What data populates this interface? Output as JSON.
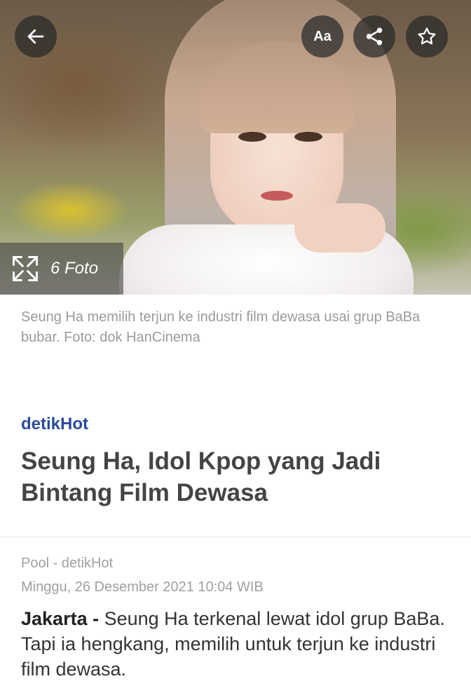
{
  "toolbar": {
    "back_icon": "arrow-left-icon",
    "font_label": "Aa",
    "share_icon": "share-icon",
    "star_icon": "star-icon"
  },
  "hero": {
    "gallery_icon": "expand-icon",
    "gallery_label": "6 Foto"
  },
  "article": {
    "caption": "Seung Ha memilih terjun ke industri film dewasa usai grup BaBa bubar. Foto: dok HanCinema",
    "channel": "detikHot",
    "title": "Seung Ha, Idol Kpop yang Jadi Bintang Film Dewasa",
    "author": "Pool - detikHot",
    "date": "Minggu, 26 Desember 2021 10:04 WIB",
    "dateline": "Jakarta -",
    "lead": "Seung Ha terkenal lewat idol grup BaBa. Tapi ia hengkang, memilih untuk terjun ke industri film dewasa."
  },
  "colors": {
    "channel": "#2b4a9a",
    "caption": "#9a9a9a",
    "button_bg": "#282828"
  }
}
